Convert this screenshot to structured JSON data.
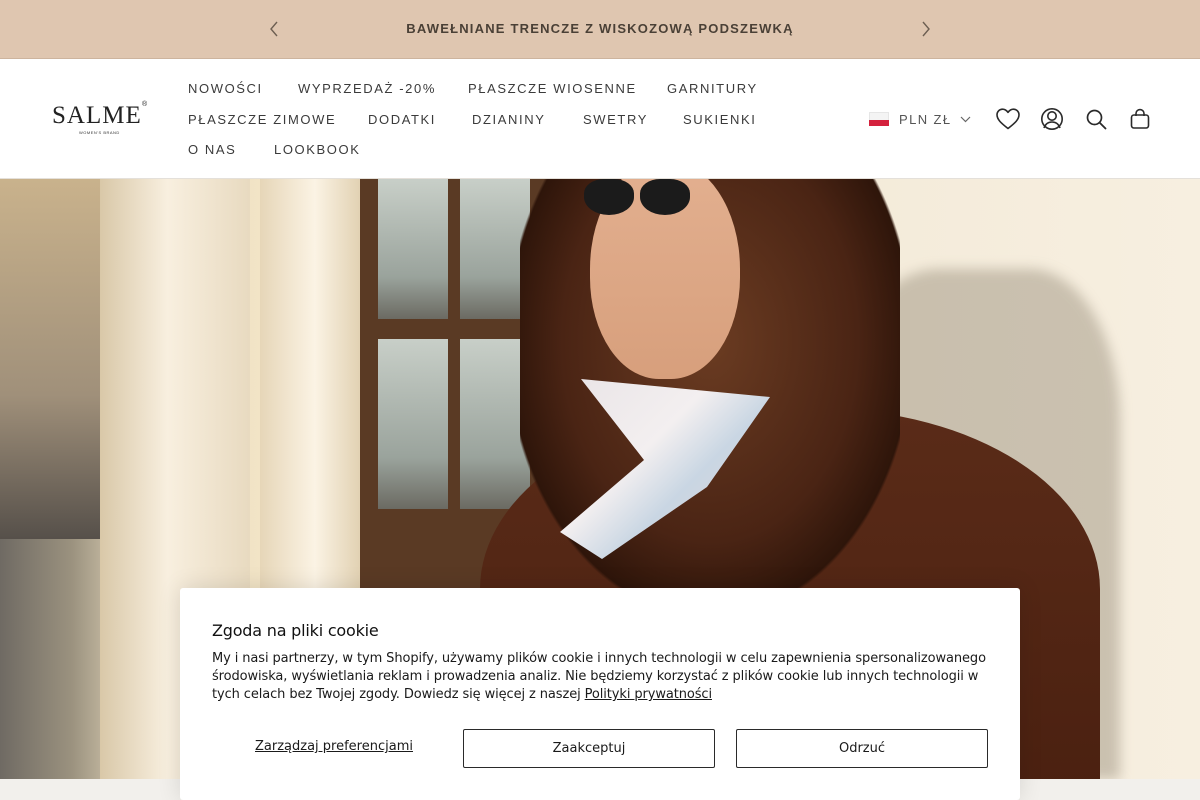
{
  "announcement": {
    "text": "BAWEŁNIANE TRENCZE Z WISKOZOWĄ PODSZEWKĄ",
    "prev_icon": "chevron-left-icon",
    "next_icon": "chevron-right-icon"
  },
  "header": {
    "logo": {
      "name": "SALME",
      "reg": "®",
      "tagline": "WOMEN'S BRAND"
    },
    "nav": [
      {
        "label": "NOWOŚCI"
      },
      {
        "label": "WYPRZEDAŻ -20%"
      },
      {
        "label": "PŁASZCZE WIOSENNE"
      },
      {
        "label": "GARNITURY"
      },
      {
        "label": "PŁASZCZE ZIMOWE"
      },
      {
        "label": "DODATKI"
      },
      {
        "label": "DZIANINY"
      },
      {
        "label": "SWETRY"
      },
      {
        "label": "SUKIENKI"
      },
      {
        "label": "O NAS"
      },
      {
        "label": "LOOKBOOK"
      }
    ],
    "currency": {
      "label": "PLN ZŁ",
      "flag": "poland-flag-icon"
    },
    "icons": [
      "heart-icon",
      "account-icon",
      "search-icon",
      "bag-icon"
    ]
  },
  "cookie_banner": {
    "title": "Zgoda na pliki cookie",
    "body": "My i nasi partnerzy, w tym Shopify, używamy plików cookie i innych technologii w celu zapewnienia spersonalizowanego środowiska, wyświetlania reklam i prowadzenia analiz. Nie będziemy korzystać z plików cookie lub innych technologii w tych celach bez Twojej zgody. Dowiedz się więcej z naszej",
    "privacy_link": "Polityki prywatności",
    "manage_label": "Zarządzaj preferencjami",
    "accept_label": "Zaakceptuj",
    "decline_label": "Odrzuć"
  },
  "colors": {
    "announcement_bg": "#dfc6b0",
    "text_dark": "#1a1a1a",
    "flag_red": "#d4213d"
  }
}
